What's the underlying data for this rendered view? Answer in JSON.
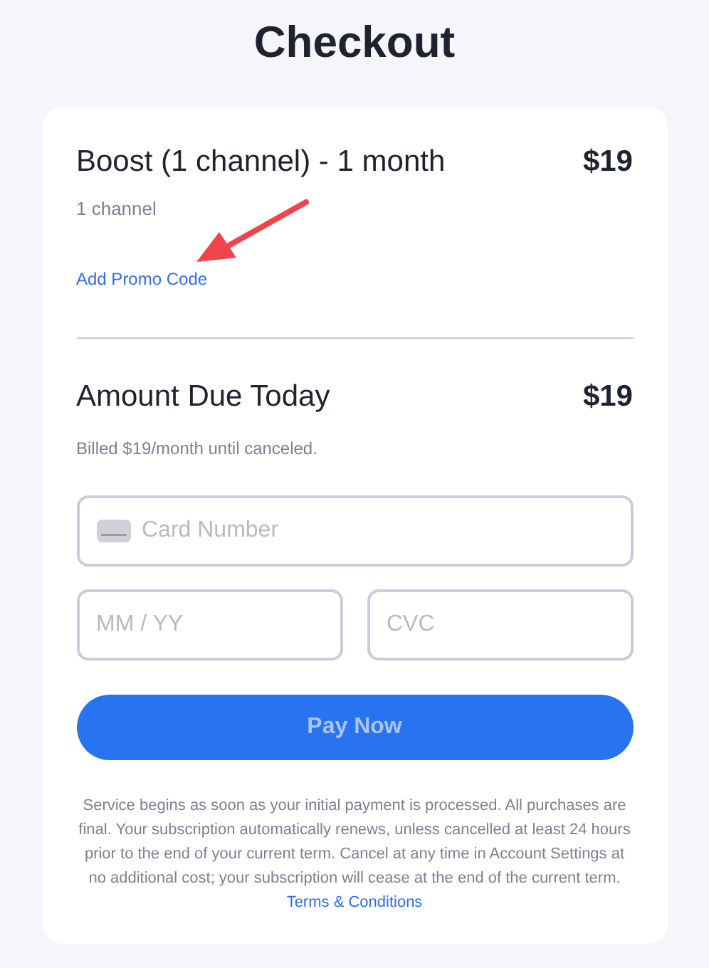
{
  "title": "Checkout",
  "item": {
    "name": "Boost (1 channel) - 1 month",
    "price": "$19",
    "detail": "1 channel",
    "promo_link": "Add Promo Code"
  },
  "amount_due": {
    "label": "Amount Due Today",
    "price": "$19",
    "note": "Billed $19/month until canceled."
  },
  "fields": {
    "card_number": {
      "placeholder": "Card Number"
    },
    "expiry": {
      "placeholder": "MM / YY"
    },
    "cvc": {
      "placeholder": "CVC"
    }
  },
  "pay_button": {
    "label": "Pay Now",
    "disabled": true
  },
  "terms": {
    "text": "Service begins as soon as your initial payment is processed. All purchases are final. Your subscription automatically renews, unless cancelled at least 24 hours prior to the end of your current term. Cancel at any time in Account Settings at no additional cost; your subscription will cease at the end of the current term.",
    "link": "Terms & Conditions"
  }
}
